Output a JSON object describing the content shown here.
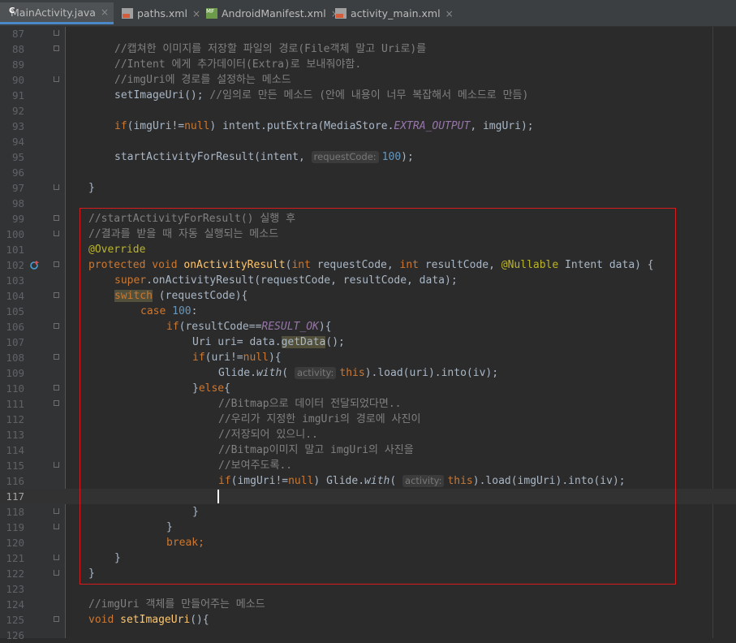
{
  "tabs": [
    {
      "label": "MainActivity.java",
      "icon": "java-class-icon",
      "active": true
    },
    {
      "label": "paths.xml",
      "icon": "xml-file-icon",
      "active": false
    },
    {
      "label": "AndroidManifest.xml",
      "icon": "manifest-file-icon",
      "active": false
    },
    {
      "label": "activity_main.xml",
      "icon": "xml-file-icon",
      "active": false
    }
  ],
  "close_glyph": "×",
  "highlight_color": "#d81b1b",
  "cursor_line": "117",
  "lines": [
    {
      "n": "87"
    },
    {
      "n": "88"
    },
    {
      "n": "89"
    },
    {
      "n": "90"
    },
    {
      "n": "91"
    },
    {
      "n": "92"
    },
    {
      "n": "93"
    },
    {
      "n": "94"
    },
    {
      "n": "95"
    },
    {
      "n": "96"
    },
    {
      "n": "97"
    },
    {
      "n": "98"
    },
    {
      "n": "99"
    },
    {
      "n": "100"
    },
    {
      "n": "101"
    },
    {
      "n": "102"
    },
    {
      "n": "103"
    },
    {
      "n": "104"
    },
    {
      "n": "105"
    },
    {
      "n": "106"
    },
    {
      "n": "107"
    },
    {
      "n": "108"
    },
    {
      "n": "109"
    },
    {
      "n": "110"
    },
    {
      "n": "111"
    },
    {
      "n": "112"
    },
    {
      "n": "113"
    },
    {
      "n": "114"
    },
    {
      "n": "115"
    },
    {
      "n": "116"
    },
    {
      "n": "117"
    },
    {
      "n": "118"
    },
    {
      "n": "119"
    },
    {
      "n": "120"
    },
    {
      "n": "121"
    },
    {
      "n": "122"
    },
    {
      "n": "123"
    },
    {
      "n": "124"
    },
    {
      "n": "125"
    },
    {
      "n": "126"
    }
  ],
  "code": {
    "l88": "//캡쳐한 이미지를 저장할 파일의 경로(File객체 말고 Uri로)를",
    "l89": "//Intent 에게 추가데이터(Extra)로 보내줘야함.",
    "l90": "//imgUri에 경로를 설정하는 메소드",
    "l91_call": "setImageUri",
    "l91_comment": "//임의로 만든 메소드 (안에 내용이 너무 복잡해서 메소드로 만듬)",
    "l93_if": "if",
    "l93_var": "imgUri!=",
    "l93_null": "null",
    "l93_rest": ") intent.putExtra(MediaStore.",
    "l93_const": "EXTRA_OUTPUT",
    "l93_tail": ", imgUri);",
    "l95_call": "startActivityForResult(intent, ",
    "l95_hint": "requestCode:",
    "l95_num": "100",
    "l95_tail": ");",
    "l97": "}",
    "l99": "//startActivityForResult() 실행 후",
    "l100": "//결과를 받을 때 자동 실행되는 메소드",
    "l101": "@Override",
    "l102_prot": "protected void ",
    "l102_fn": "onActivityResult",
    "l102_p1": "(",
    "l102_int1": "int ",
    "l102_a1": "requestCode, ",
    "l102_int2": "int ",
    "l102_a2": "resultCode, ",
    "l102_ann": "@Nullable ",
    "l102_tail": "Intent data) {",
    "l103_super": "super",
    "l103_rest": ".onActivityResult(requestCode, resultCode, data);",
    "l104_sw": "switch",
    "l104_rest": " (requestCode){",
    "l105_case": "case ",
    "l105_num": "100",
    "l105_colon": ":",
    "l106_if": "if",
    "l106_a": "(resultCode==",
    "l106_const": "RESULT_OK",
    "l106_b": "){",
    "l107_a": "Uri uri= data.",
    "l107_fn": "getData",
    "l107_b": "();",
    "l108_if": "if",
    "l108_a": "(uri!=",
    "l108_null": "null",
    "l108_b": "){",
    "l109_a": "Glide.",
    "l109_with": "with",
    "l109_p": "( ",
    "l109_hint": "activity:",
    "l109_this": "this",
    "l109_b": ").load(uri).into(iv);",
    "l110_a": "}",
    "l110_else": "else",
    "l110_b": "{",
    "l111": "//Bitmap으로 데이터 전달되었다면..",
    "l112": "//우리가 지정한 imgUri의 경로에 사진이",
    "l113": "//저장되어 있으니..",
    "l114": "//Bitmap이미지 말고 imgUri의 사진을",
    "l115": "//보여주도록..",
    "l116_if": "if",
    "l116_a": "(imgUri!=",
    "l116_null": "null",
    "l116_b": ") Glide.",
    "l116_with": "with",
    "l116_p": "( ",
    "l116_hint": "activity:",
    "l116_this": "this",
    "l116_c": ").load(imgUri).into(iv);",
    "l118": "}",
    "l119": "}",
    "l120": "break;",
    "l121": "}",
    "l122": "}",
    "l124": "//imgUri 객체를 만들어주는 메소드",
    "l125_void": "void ",
    "l125_fn": "setImageUri",
    "l125_tail": "(){",
    "l91_tail": "();"
  }
}
